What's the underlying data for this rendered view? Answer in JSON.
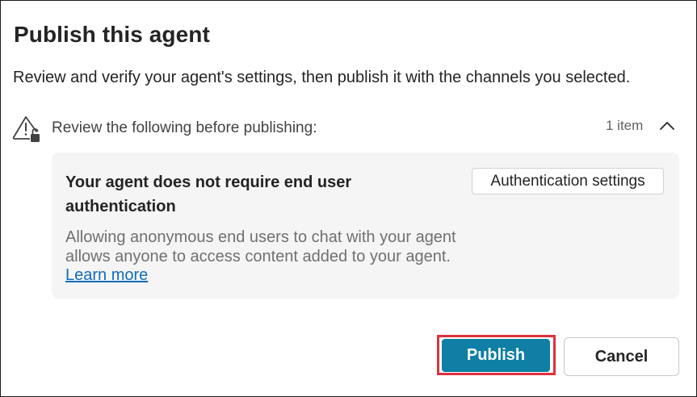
{
  "dialog": {
    "title": "Publish this agent",
    "description": "Review and verify your agent's settings, then publish it with the channels you selected."
  },
  "review": {
    "label": "Review the following before publishing:",
    "count": "1 item",
    "icon": "warning-lock-icon",
    "toggle_icon": "chevron-up-icon"
  },
  "card": {
    "title": "Your agent does not require end user authentication",
    "body": "Allowing anonymous end users to chat with your agent allows anyone to access content added to your agent.",
    "link": "Learn more",
    "button": "Authentication settings"
  },
  "footer": {
    "publish": "Publish",
    "cancel": "Cancel"
  },
  "colors": {
    "primary": "#0f7fa6",
    "highlight": "#e0303d",
    "link": "#0f6cbd",
    "card_background": "#f5f5f5"
  }
}
